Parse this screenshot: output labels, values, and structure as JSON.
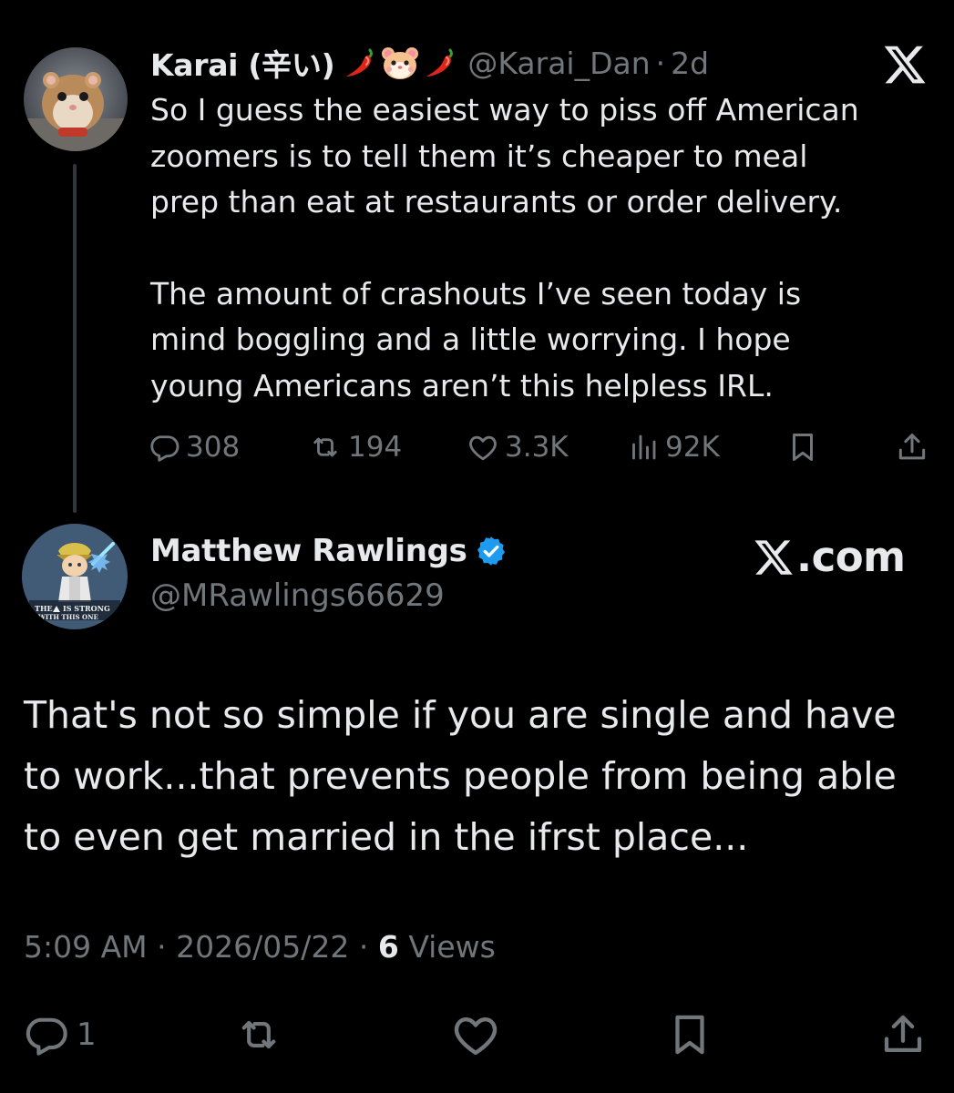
{
  "parent_tweet": {
    "display_name": "Karai (辛い)",
    "name_emojis": [
      "hot-pepper-icon",
      "hamster-face-icon",
      "hot-pepper-icon"
    ],
    "handle": "@Karai_Dan",
    "separator": "·",
    "age": "2d",
    "paragraph_1": "So I guess the easiest way to piss off American\nzoomers is to tell them it’s cheaper to meal\nprep than eat at restaurants or order delivery.",
    "paragraph_2": "The amount of crashouts I’ve seen today is\nmind boggling and a little worrying. I hope\nyoung Americans aren’t this helpless IRL.",
    "stats": {
      "replies": "308",
      "reposts": "194",
      "likes": "3.3K",
      "views": "92K"
    }
  },
  "reply_tweet": {
    "display_name": "Matthew Rawlings",
    "verified": true,
    "handle": "@MRawlings66629",
    "watermark": ".com",
    "body": "That's not so simple if you are single and have to work...that prevents people from being able to even get married in the ifrst place...",
    "time": "5:09 AM",
    "date": "2026/05/22",
    "separator": "·",
    "view_count": "6",
    "views_label": "Views",
    "reply_count": "1"
  },
  "avatar_badge_text": [
    "THE",
    "IS STRONG",
    "WITH THIS ONE"
  ],
  "colors": {
    "background": "#000000",
    "primary_text": "#e7e9ea",
    "secondary_text": "#71767b",
    "verified_blue": "#1d9bf0",
    "thread_line": "#333639"
  }
}
